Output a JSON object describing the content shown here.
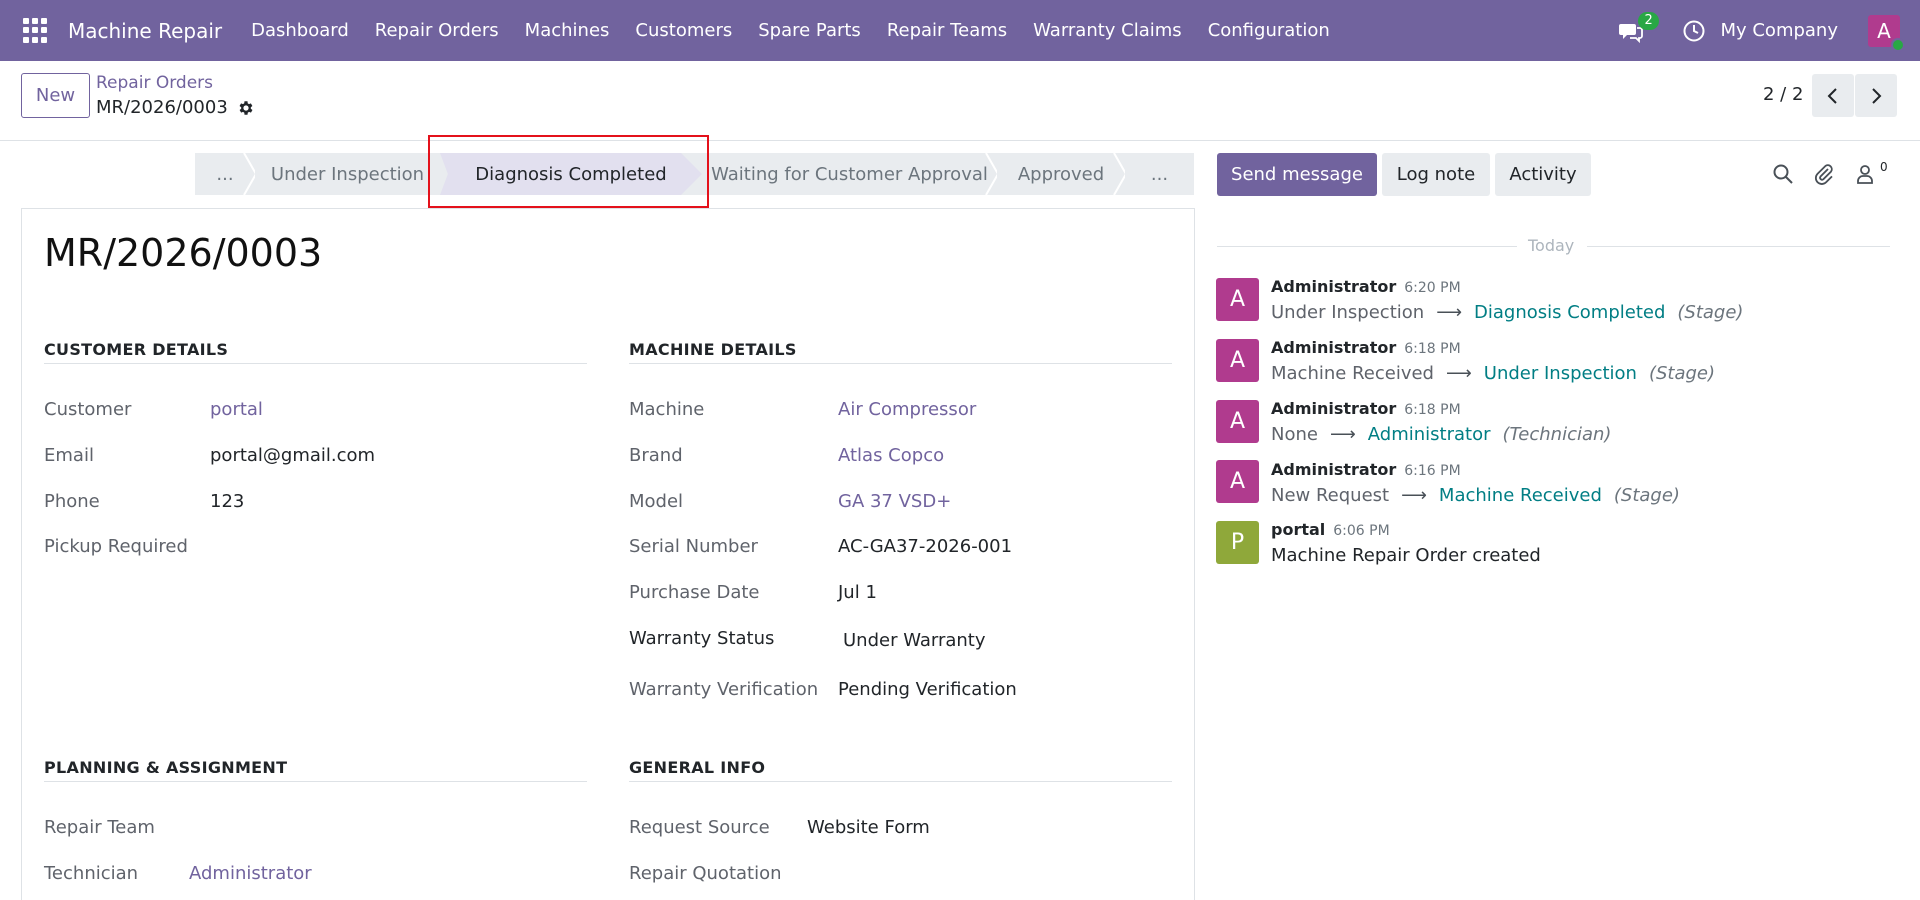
{
  "navbar": {
    "app_title": "Machine Repair",
    "menu": [
      "Dashboard",
      "Repair Orders",
      "Machines",
      "Customers",
      "Spare Parts",
      "Repair Teams",
      "Warranty Claims",
      "Configuration"
    ],
    "chat_count": "2",
    "company": "My Company",
    "user_initial": "A",
    "colors": {
      "brand": "#71639e",
      "online": "#28a745"
    }
  },
  "control": {
    "new_label": "New",
    "breadcrumb_parent": "Repair Orders",
    "breadcrumb_current": "MR/2026/0003",
    "pager": "2 / 2"
  },
  "statusbar": {
    "stages": [
      "...",
      "Under Inspection",
      "Diagnosis Completed",
      "Waiting for Customer Approval",
      "Approved",
      "..."
    ],
    "active": "Diagnosis Completed"
  },
  "chatter_buttons": {
    "send_message": "Send message",
    "log_note": "Log note",
    "activity": "Activity",
    "followers": "0"
  },
  "form": {
    "name": "MR/2026/0003",
    "customer_details": {
      "title": "CUSTOMER DETAILS",
      "customer_label": "Customer",
      "customer": "portal",
      "email_label": "Email",
      "email": "portal@gmail.com",
      "phone_label": "Phone",
      "phone": "123",
      "pickup_label": "Pickup Required"
    },
    "machine_details": {
      "title": "MACHINE DETAILS",
      "machine_label": "Machine",
      "machine": "Air Compressor",
      "brand_label": "Brand",
      "brand": "Atlas Copco",
      "model_label": "Model",
      "model": "GA 37 VSD+",
      "serial_label": "Serial Number",
      "serial": "AC-GA37-2026-001",
      "purchase_label": "Purchase Date",
      "purchase": "Jul 1",
      "warranty_status_label": "Warranty Status",
      "warranty_status": "Under Warranty",
      "warranty_verification_label": "Warranty Verification",
      "warranty_verification": "Pending Verification"
    },
    "planning": {
      "title": "PLANNING & ASSIGNMENT",
      "team_label": "Repair Team",
      "technician_label": "Technician",
      "technician": "Administrator"
    },
    "general": {
      "title": "GENERAL INFO",
      "source_label": "Request Source",
      "source": "Website Form",
      "quotation_label": "Repair Quotation"
    }
  },
  "thread": {
    "today": "Today",
    "messages": [
      {
        "initial": "A",
        "author": "Administrator",
        "time": "6:20 PM",
        "old": "Under Inspection",
        "new": "Diagnosis Completed",
        "field": "(Stage)"
      },
      {
        "initial": "A",
        "author": "Administrator",
        "time": "6:18 PM",
        "old": "Machine Received",
        "new": "Under Inspection",
        "field": "(Stage)"
      },
      {
        "initial": "A",
        "author": "Administrator",
        "time": "6:18 PM",
        "old": "None",
        "new": "Administrator",
        "field": "(Technician)"
      },
      {
        "initial": "A",
        "author": "Administrator",
        "time": "6:16 PM",
        "old": "New Request",
        "new": "Machine Received",
        "field": "(Stage)"
      },
      {
        "initial": "P",
        "author": "portal",
        "time": "6:06 PM",
        "text": "Machine Repair Order created"
      }
    ],
    "colors": {
      "admin": "#b03b8e",
      "portal": "#8fa83a",
      "link": "#017e84"
    }
  }
}
